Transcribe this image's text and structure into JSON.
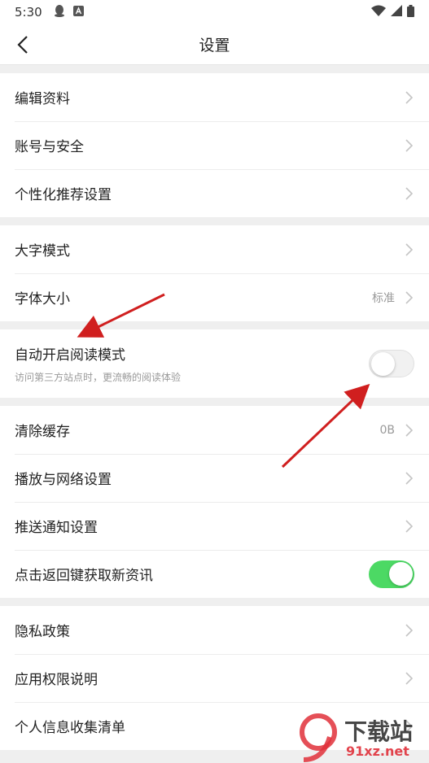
{
  "status": {
    "time": "5:30"
  },
  "nav": {
    "title": "设置"
  },
  "groups": {
    "g1": [
      "编辑资料",
      "账号与安全",
      "个性化推荐设置"
    ],
    "g2_large_text": "大字模式",
    "g2_font_size": "字体大小",
    "g2_font_size_value": "标准",
    "reading": {
      "title": "自动开启阅读模式",
      "subtitle": "访问第三方站点时，更流畅的阅读体验",
      "enabled": false
    },
    "clear_cache": "清除缓存",
    "clear_cache_value": "0B",
    "playback": "播放与网络设置",
    "push": "推送通知设置",
    "back_refresh": {
      "title": "点击返回键获取新资讯",
      "enabled": true
    },
    "g5": [
      "隐私政策",
      "应用权限说明",
      "个人信息收集清单"
    ]
  },
  "watermark": {
    "big": "下载站",
    "small": "91xz.net"
  },
  "colors": {
    "toggle_on": "#4cd964",
    "annotation_arrow": "#d01f1f",
    "watermark": "#e0303a"
  }
}
